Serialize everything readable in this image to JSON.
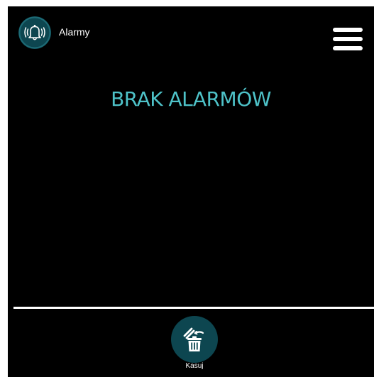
{
  "header": {
    "title": "Alarmy",
    "icon": "alarm-bell-icon",
    "menu_icon": "hamburger-menu-icon"
  },
  "main": {
    "empty_message": "BRAK ALARMÓW"
  },
  "footer": {
    "delete_label": "Kasuj",
    "delete_icon": "clear-trash-icon"
  },
  "colors": {
    "background": "#000000",
    "accent_text": "#4ec2c8",
    "icon_circle": "#0d4650",
    "foreground": "#ffffff"
  }
}
